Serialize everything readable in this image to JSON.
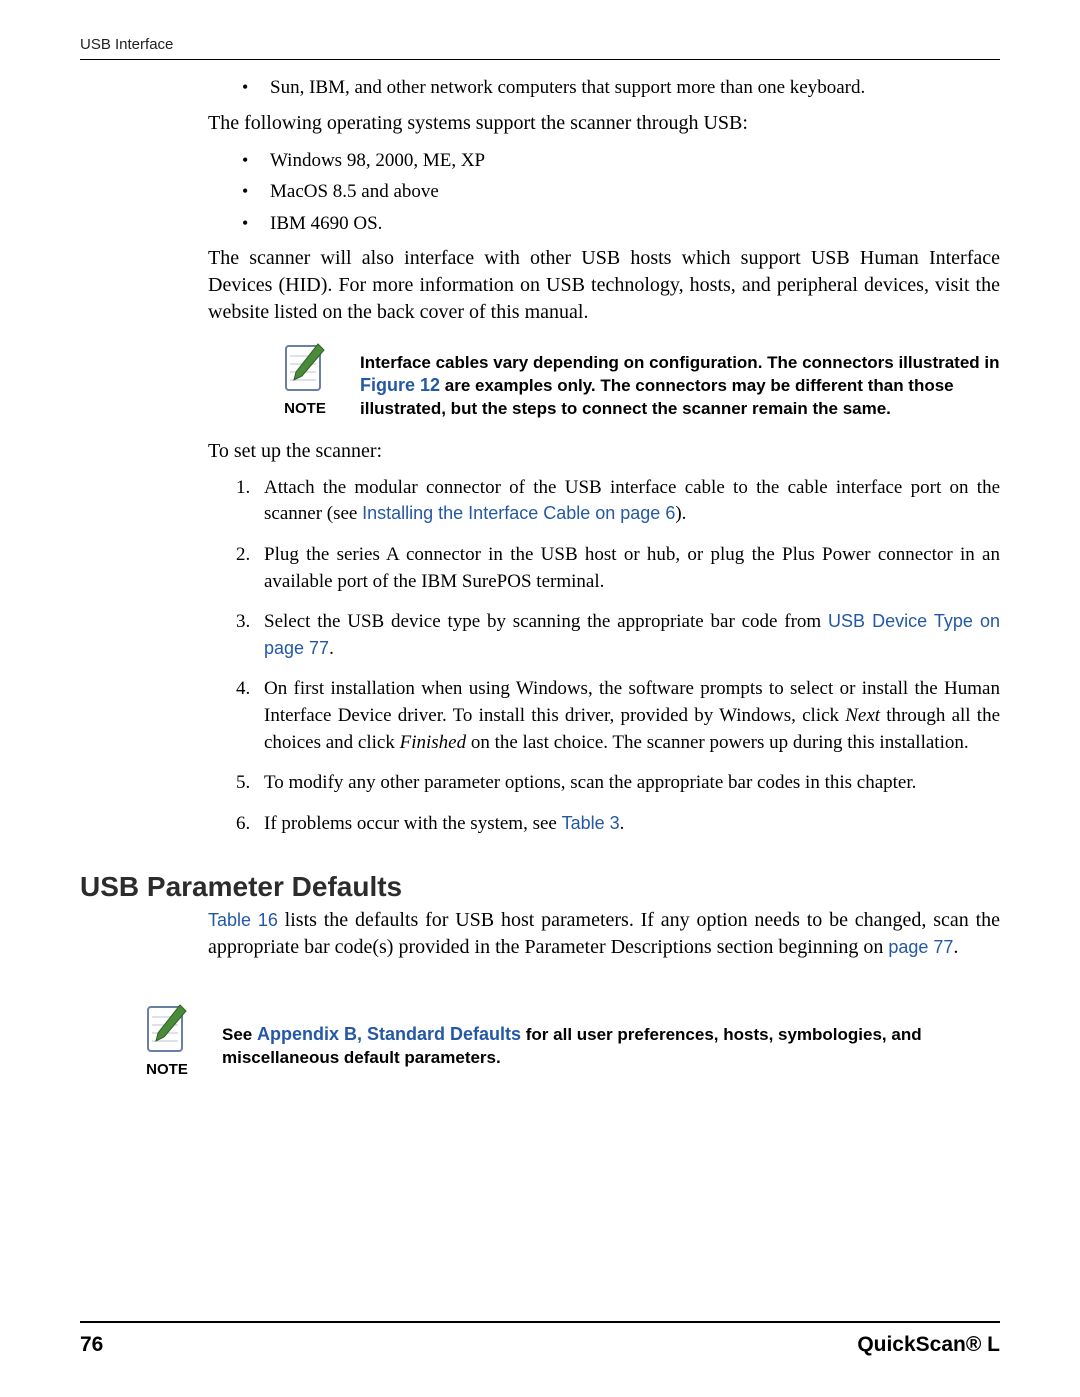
{
  "running_head": "USB Interface",
  "intro_bullets": [
    "Sun, IBM, and other network computers that support more than one keyboard."
  ],
  "os_intro": "The following operating systems support the scanner through USB:",
  "os_bullets": [
    "Windows 98, 2000, ME, XP",
    "MacOS 8.5 and above",
    "IBM 4690 OS."
  ],
  "hid_para": "The scanner will also interface with other USB hosts which support USB Human Interface Devices (HID). For more information on USB technology, hosts, and peripheral devices, visit the website listed on the back cover of this manual.",
  "note1": {
    "label": "NOTE",
    "pre": "Interface cables vary depending on configuration. The connectors illustrated in ",
    "link": "Figure 12",
    "post": " are examples only. The connectors may be different than those illustrated, but the steps to connect the scanner remain the same."
  },
  "setup_intro": "To set up the scanner:",
  "steps": {
    "s1_pre": "Attach the modular connector of the USB interface cable to the cable interface port on the scanner (see ",
    "s1_link": "Installing the Interface Cable on page 6",
    "s1_post": ").",
    "s2": "Plug the series A connector in the USB host or hub, or plug the Plus Power connector in an available port of the IBM SurePOS terminal.",
    "s3_pre": "Select the USB device type by scanning the appropriate bar code from ",
    "s3_link": "USB Device Type on page 77",
    "s3_post": ".",
    "s4_a": "On first installation when using Windows, the software prompts to select or install the Human Interface Device driver. To install this driver, provided by Windows, click ",
    "s4_next": "Next",
    "s4_b": " through all the choices and click ",
    "s4_finished": "Finished",
    "s4_c": " on the last choice. The scanner powers up during this installation.",
    "s5": "To modify any other parameter options, scan the appropriate bar codes in this chapter.",
    "s6_pre": "If problems occur with the system, see ",
    "s6_link": "Table 3",
    "s6_post": "."
  },
  "heading": "USB Parameter Defaults",
  "defaults_para": {
    "link1": "Table 16",
    "mid": " lists the defaults for USB host parameters. If any option needs to be changed, scan the appropriate bar code(s) provided in the Parameter Descriptions section beginning on ",
    "link2": "page 77",
    "post": "."
  },
  "note2": {
    "label": "NOTE",
    "pre": "See ",
    "link": "Appendix B, Standard Defaults",
    "post": " for all user preferences, hosts, symbologies, and miscellaneous default parameters."
  },
  "footer": {
    "page": "76",
    "title": "QuickScan® L"
  }
}
